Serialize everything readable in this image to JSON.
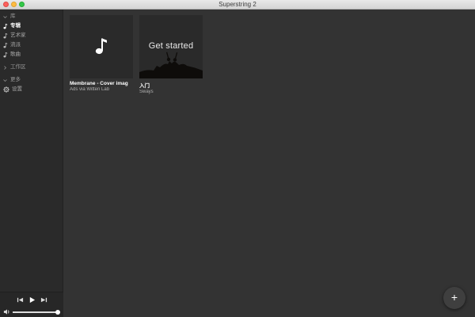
{
  "window": {
    "title": "Superstring 2"
  },
  "sidebar": {
    "library_header": "库",
    "library_items": [
      {
        "label": "专辑",
        "active": true
      },
      {
        "label": "艺术家",
        "active": false
      },
      {
        "label": "流派",
        "active": false
      },
      {
        "label": "歌曲",
        "active": false
      }
    ],
    "workspace_header": "工作区",
    "more_header": "更多",
    "settings_label": "设置"
  },
  "player": {
    "volume_percent": 95
  },
  "albums": [
    {
      "title": "Membrane - Cover imag",
      "subtitle": "Ads via Witten Lab",
      "cover": "music-note"
    },
    {
      "title": "入门",
      "subtitle": "Sways",
      "cover_text": "Get started"
    }
  ],
  "fab": {
    "label": "+"
  },
  "colors": {
    "background": "#333333",
    "sidebar": "#2a2a2a",
    "accent": "#ffffff"
  }
}
